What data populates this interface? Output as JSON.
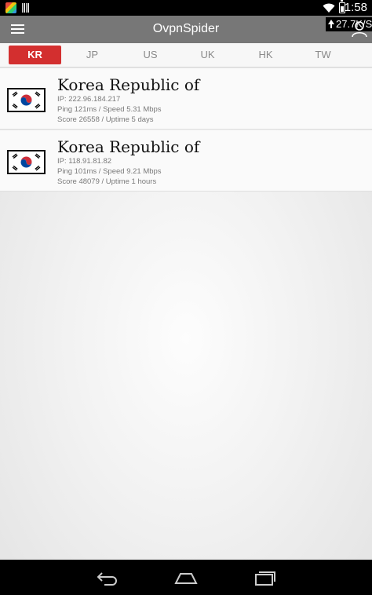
{
  "status_bar": {
    "time": "1:58",
    "icons": [
      "app-thumbnail-icon",
      "barcode-icon",
      "wifi-icon",
      "battery-icon"
    ]
  },
  "action_bar": {
    "title": "OvpnSpider",
    "speed": "27.7K/S",
    "icons": [
      "menu-icon",
      "upload-arrow-icon",
      "user-icon"
    ]
  },
  "tabs": [
    {
      "label": "KR",
      "active": true
    },
    {
      "label": "JP",
      "active": false
    },
    {
      "label": "US",
      "active": false
    },
    {
      "label": "UK",
      "active": false
    },
    {
      "label": "HK",
      "active": false
    },
    {
      "label": "TW",
      "active": false
    }
  ],
  "servers": [
    {
      "country": "Korea Republic of",
      "ip": "IP: 222.96.184.217",
      "ping_speed": "Ping 121ms / Speed 5.31 Mbps",
      "score_uptime": "Score 26558 / Uptime 5 days",
      "flag_icon": "south-korea-flag-icon"
    },
    {
      "country": "Korea Republic of",
      "ip": "IP: 118.91.81.82",
      "ping_speed": "Ping 101ms / Speed 9.21 Mbps",
      "score_uptime": "Score 48079 / Uptime 1 hours",
      "flag_icon": "south-korea-flag-icon"
    }
  ],
  "nav_bar": {
    "icons": [
      "back-icon",
      "home-icon",
      "recent-apps-icon"
    ]
  },
  "colors": {
    "action_bar": "#777777",
    "active_tab": "#d32f2f",
    "tab_text": "#8a8a8a"
  }
}
